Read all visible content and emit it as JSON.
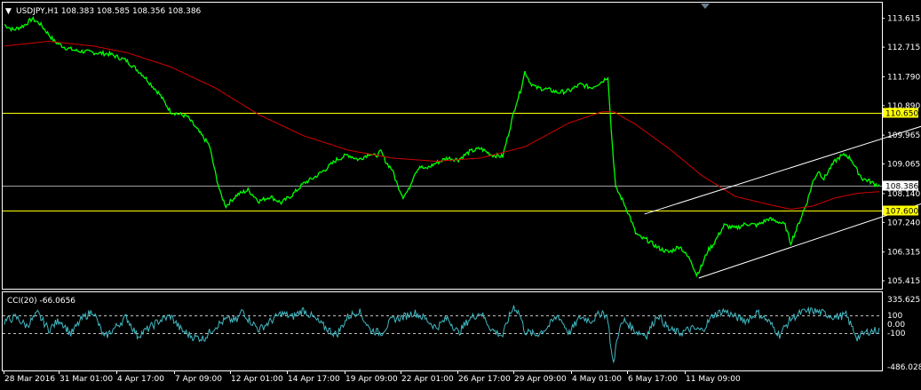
{
  "chart_data": [
    {
      "type": "line",
      "title": "USDJPY,H1  108.383 108.585 108.356 108.386",
      "ylim": [
        105.25,
        114.05
      ],
      "y_ticks": [
        "113.615",
        "112.715",
        "111.790",
        "110.890",
        "109.965",
        "109.065",
        "108.140",
        "107.240",
        "106.315",
        "105.415"
      ],
      "x_ticks": [
        "28 Mar 2016",
        "31 Mar 01:00",
        "4 Apr 17:00",
        "7 Apr 09:00",
        "12 Apr 01:00",
        "14 Apr 17:00",
        "19 Apr 09:00",
        "22 Apr 01:00",
        "26 Apr 17:00",
        "29 Apr 09:00",
        "4 May 01:00",
        "6 May 17:00",
        "11 May 09:00"
      ],
      "bar_count": 790,
      "series": [
        {
          "color": "#00ff00",
          "x": [
            0,
            8,
            18,
            25,
            32,
            38,
            45,
            55,
            65,
            80,
            95,
            110,
            125,
            140,
            150,
            165,
            175,
            185,
            190,
            195,
            200,
            210,
            220,
            230,
            240,
            250,
            260,
            270,
            280,
            290,
            300,
            310,
            320,
            330,
            335,
            340,
            345,
            350,
            355,
            360,
            365,
            370,
            375,
            380,
            390,
            400,
            410,
            420,
            430,
            440,
            450,
            458,
            462,
            466,
            470,
            475,
            480,
            490,
            500,
            510,
            520,
            530,
            540,
            545,
            548,
            550,
            552,
            555,
            560,
            565,
            570,
            575,
            580,
            590,
            600,
            610,
            615,
            620,
            625,
            630,
            635,
            640,
            645,
            650,
            660,
            670,
            680,
            690,
            700,
            705,
            710,
            715,
            720,
            725,
            730,
            735,
            740,
            745,
            750,
            755,
            760,
            765,
            770,
            775,
            780,
            785,
            790
          ],
          "values": [
            113.42,
            113.25,
            113.4,
            113.6,
            113.45,
            113.2,
            112.9,
            112.7,
            112.6,
            112.55,
            112.5,
            112.3,
            111.85,
            111.25,
            110.7,
            110.55,
            110.1,
            109.65,
            108.85,
            108.15,
            107.75,
            108.1,
            108.25,
            107.9,
            108.05,
            107.85,
            108.1,
            108.45,
            108.65,
            108.9,
            109.2,
            109.35,
            109.2,
            109.4,
            109.3,
            109.45,
            109.1,
            108.9,
            108.4,
            108.05,
            108.25,
            108.75,
            109.0,
            108.9,
            109.1,
            109.25,
            109.2,
            109.45,
            109.55,
            109.35,
            109.3,
            110.4,
            110.95,
            111.35,
            111.95,
            111.6,
            111.45,
            111.4,
            111.3,
            111.35,
            111.55,
            111.45,
            111.65,
            111.8,
            110.1,
            109.2,
            108.3,
            108.15,
            107.8,
            107.4,
            106.9,
            106.75,
            106.7,
            106.45,
            106.3,
            106.5,
            106.25,
            106.05,
            105.6,
            105.9,
            106.35,
            106.55,
            106.85,
            107.15,
            107.05,
            107.2,
            107.15,
            107.35,
            107.25,
            107.15,
            106.6,
            107.0,
            107.45,
            107.9,
            108.5,
            108.85,
            108.6,
            108.9,
            109.15,
            109.3,
            109.35,
            109.2,
            108.85,
            108.6,
            108.55,
            108.45,
            108.4
          ],
          "noise": 0.07
        },
        {
          "color": "#d40000",
          "x": [
            0,
            40,
            80,
            110,
            150,
            190,
            230,
            270,
            310,
            350,
            390,
            430,
            470,
            510,
            540,
            550,
            570,
            600,
            630,
            660,
            690,
            710,
            730,
            750,
            770,
            790
          ],
          "values": [
            112.75,
            112.9,
            112.75,
            112.55,
            112.1,
            111.45,
            110.6,
            109.95,
            109.5,
            109.25,
            109.15,
            109.25,
            109.6,
            110.35,
            110.7,
            110.7,
            110.3,
            109.55,
            108.7,
            108.05,
            107.8,
            107.65,
            107.75,
            108.0,
            108.15,
            108.2
          ]
        }
      ],
      "h_lines": [
        {
          "value": 110.65,
          "color": "#ffff00",
          "label": "110.650",
          "label_bg": "#ffff00",
          "label_fg": "#000000"
        },
        {
          "value": 107.6,
          "color": "#ffff00",
          "label": "107.600",
          "label_bg": "#ffff00",
          "label_fg": "#000000"
        },
        {
          "value": 108.386,
          "color": "#a0a0a0",
          "label": "108.386",
          "label_bg": "#ffffff",
          "label_fg": "#000000"
        }
      ],
      "channel_lines": [
        {
          "x1": 578,
          "y1": 107.5,
          "x2": 888,
          "y2": 110.9
        },
        {
          "x1": 627,
          "y1": 105.5,
          "x2": 943,
          "y2": 109.15
        }
      ],
      "arrow": {
        "color": "#0000ff",
        "from_x": 880,
        "from_y": 105.5,
        "to_x": 832,
        "to_y": 107.3
      }
    },
    {
      "type": "line",
      "title": "CCI(20) -66.0656",
      "ylim": [
        -486.0282,
        335.6251
      ],
      "y_ticks": [
        "335.6251",
        "100",
        "0.00",
        "-100",
        "-486.0282"
      ],
      "levels": [
        100,
        -100
      ],
      "series": [
        {
          "color": "#41b8c2",
          "x": [
            0,
            10,
            20,
            30,
            40,
            50,
            60,
            70,
            80,
            90,
            100,
            110,
            120,
            130,
            140,
            150,
            160,
            170,
            180,
            190,
            200,
            210,
            215,
            220,
            230,
            240,
            250,
            260,
            270,
            280,
            290,
            300,
            310,
            320,
            330,
            340,
            350,
            360,
            370,
            380,
            390,
            400,
            410,
            420,
            430,
            440,
            450,
            455,
            460,
            465,
            470,
            480,
            490,
            500,
            510,
            520,
            530,
            540,
            545,
            548,
            550,
            552,
            555,
            560,
            570,
            580,
            590,
            600,
            610,
            620,
            630,
            640,
            650,
            660,
            670,
            680,
            690,
            700,
            710,
            720,
            730,
            740,
            750,
            760,
            770,
            780,
            790
          ],
          "values": [
            30,
            80,
            -20,
            120,
            -60,
            50,
            -110,
            60,
            150,
            -150,
            -40,
            80,
            -130,
            -50,
            40,
            90,
            -70,
            -140,
            -160,
            -30,
            50,
            40,
            160,
            60,
            -60,
            30,
            120,
            80,
            160,
            60,
            -40,
            -120,
            80,
            150,
            -60,
            -100,
            50,
            80,
            130,
            60,
            -40,
            70,
            -100,
            60,
            130,
            -60,
            -130,
            60,
            200,
            120,
            -80,
            -120,
            -40,
            100,
            -100,
            80,
            40,
            140,
            60,
            -300,
            -460,
            -250,
            -60,
            40,
            -80,
            -120,
            110,
            -60,
            -100,
            -50,
            -70,
            100,
            150,
            80,
            40,
            130,
            30,
            -120,
            60,
            130,
            150,
            120,
            80,
            100,
            -150,
            -80,
            -66
          ]
        }
      ]
    }
  ]
}
